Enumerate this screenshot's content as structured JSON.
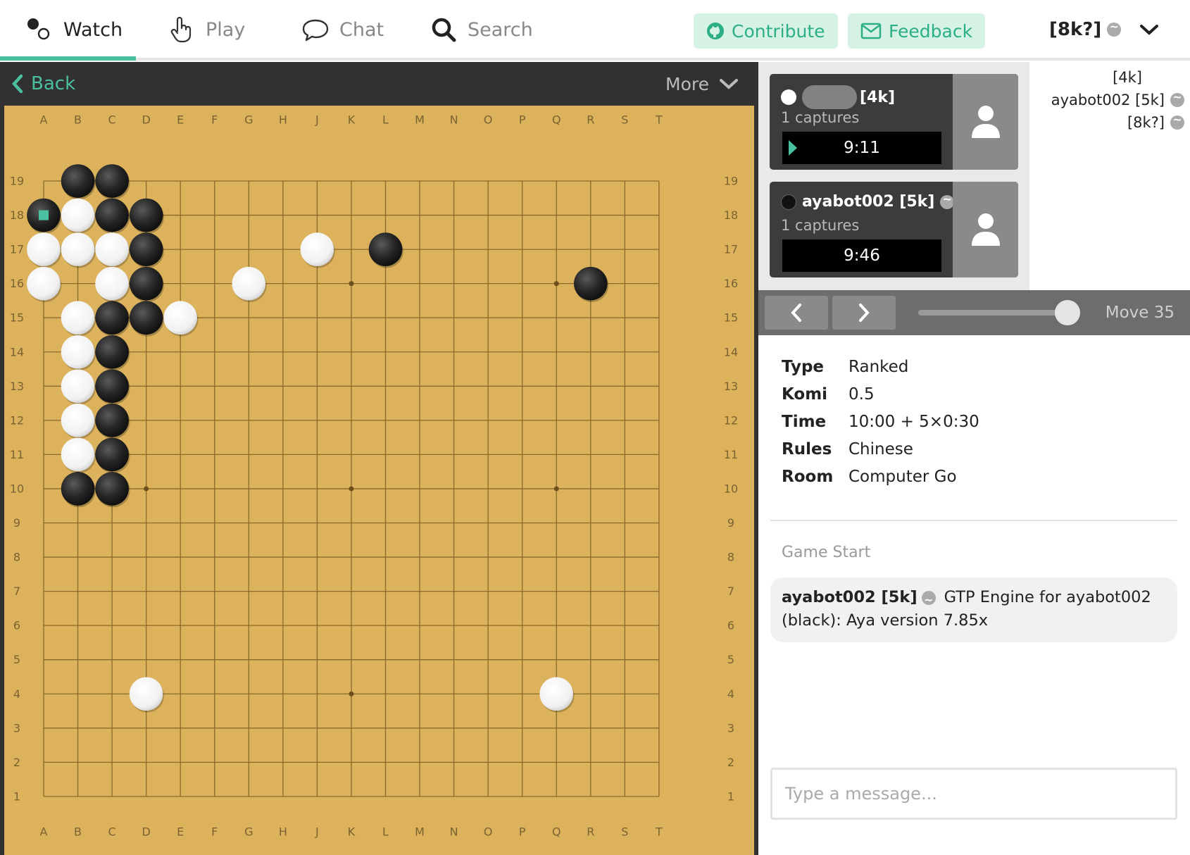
{
  "nav": {
    "watch": "Watch",
    "play": "Play",
    "chat": "Chat",
    "search": "Search",
    "contribute": "Contribute",
    "feedback": "Feedback",
    "user_rank": "[8k?]"
  },
  "board_header": {
    "back": "Back",
    "more": "More"
  },
  "board": {
    "columns": [
      "A",
      "B",
      "C",
      "D",
      "E",
      "F",
      "G",
      "H",
      "J",
      "K",
      "L",
      "M",
      "N",
      "O",
      "P",
      "Q",
      "R",
      "S",
      "T"
    ],
    "rows": [
      "19",
      "18",
      "17",
      "16",
      "15",
      "14",
      "13",
      "12",
      "11",
      "10",
      "9",
      "8",
      "7",
      "6",
      "5",
      "4",
      "3",
      "2",
      "1"
    ],
    "black_stones": [
      "B19",
      "C19",
      "A18",
      "C18",
      "D18",
      "D17",
      "L17",
      "D16",
      "R16",
      "C15",
      "D15",
      "C14",
      "C13",
      "C12",
      "C11",
      "B10",
      "C10"
    ],
    "white_stones": [
      "B18",
      "A17",
      "B17",
      "C17",
      "J17",
      "A16",
      "C16",
      "G16",
      "B15",
      "E15",
      "B14",
      "B13",
      "B12",
      "B11",
      "D4",
      "Q4"
    ],
    "last_move": "A18",
    "star_points": [
      "D16",
      "K16",
      "Q16",
      "D10",
      "K10",
      "Q10",
      "D4",
      "K4",
      "Q4"
    ]
  },
  "players": {
    "white": {
      "name": "[4k]",
      "captures": "1 captures",
      "clock": "9:11"
    },
    "black": {
      "name": "ayabot002 [5k]",
      "captures": "1 captures",
      "clock": "9:46"
    }
  },
  "spectators": [
    "[4k]",
    "ayabot002 [5k]",
    "[8k?]"
  ],
  "move": {
    "label": "Move 35",
    "progress": 1.0
  },
  "game_info": [
    {
      "key": "Type",
      "value": "Ranked"
    },
    {
      "key": "Komi",
      "value": "0.5"
    },
    {
      "key": "Time",
      "value": "10:00 + 5×0:30"
    },
    {
      "key": "Rules",
      "value": "Chinese"
    },
    {
      "key": "Room",
      "value": "Computer Go"
    }
  ],
  "chat": {
    "game_start": "Game Start",
    "message_author": "ayabot002 [5k]",
    "message_line1": "GTP Engine for ayabot002",
    "message_line2": "(black): Aya version 7.85x",
    "input_placeholder": "Type a message..."
  },
  "colors": {
    "accent": "#4bc0a0",
    "board": "#dcb35c",
    "panel_dark": "#313131"
  }
}
